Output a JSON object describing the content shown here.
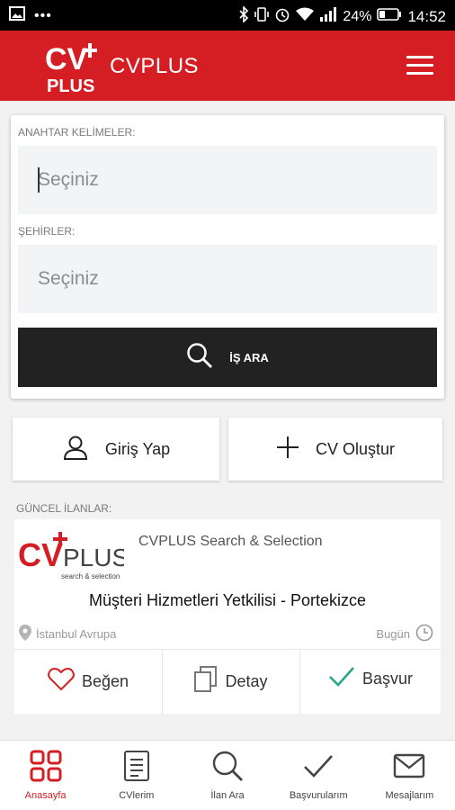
{
  "statusbar": {
    "battery": "24%",
    "time": "14:52"
  },
  "appbar": {
    "title": "CVPLUS",
    "logo_text": "CV PLUS"
  },
  "search": {
    "keywords_label": "ANAHTAR KELİMELER:",
    "keywords_placeholder": "Seçiniz",
    "cities_label": "ŞEHİRLER:",
    "cities_placeholder": "Seçiniz",
    "button_label": "İŞ ARA"
  },
  "actions": {
    "login_label": "Giriş Yap",
    "create_cv_label": "CV Oluştur"
  },
  "listings": {
    "section_label": "GÜNCEL İLANLAR:",
    "job": {
      "company": "CVPLUS Search & Selection",
      "logo_text": "CVPLUS",
      "logo_tagline": "search & selection",
      "title": "Müşteri Hizmetleri Yetkilisi  -  Portekizce",
      "location": "İstanbul Avrupa",
      "date": "Bugün",
      "like_label": "Beğen",
      "detail_label": "Detay",
      "apply_label": "Başvur"
    }
  },
  "bottom_nav": [
    {
      "label": "Anasayfa",
      "icon": "grid-icon",
      "active": true
    },
    {
      "label": "CVlerim",
      "icon": "document-icon",
      "active": false
    },
    {
      "label": "İlan Ara",
      "icon": "search-icon",
      "active": false
    },
    {
      "label": "Başvurularım",
      "icon": "check-icon",
      "active": false
    },
    {
      "label": "Mesajlarım",
      "icon": "mail-icon",
      "active": false
    }
  ],
  "colors": {
    "brand": "#d51e24",
    "button_dark": "#222222",
    "apply_green": "#2aa58d"
  }
}
